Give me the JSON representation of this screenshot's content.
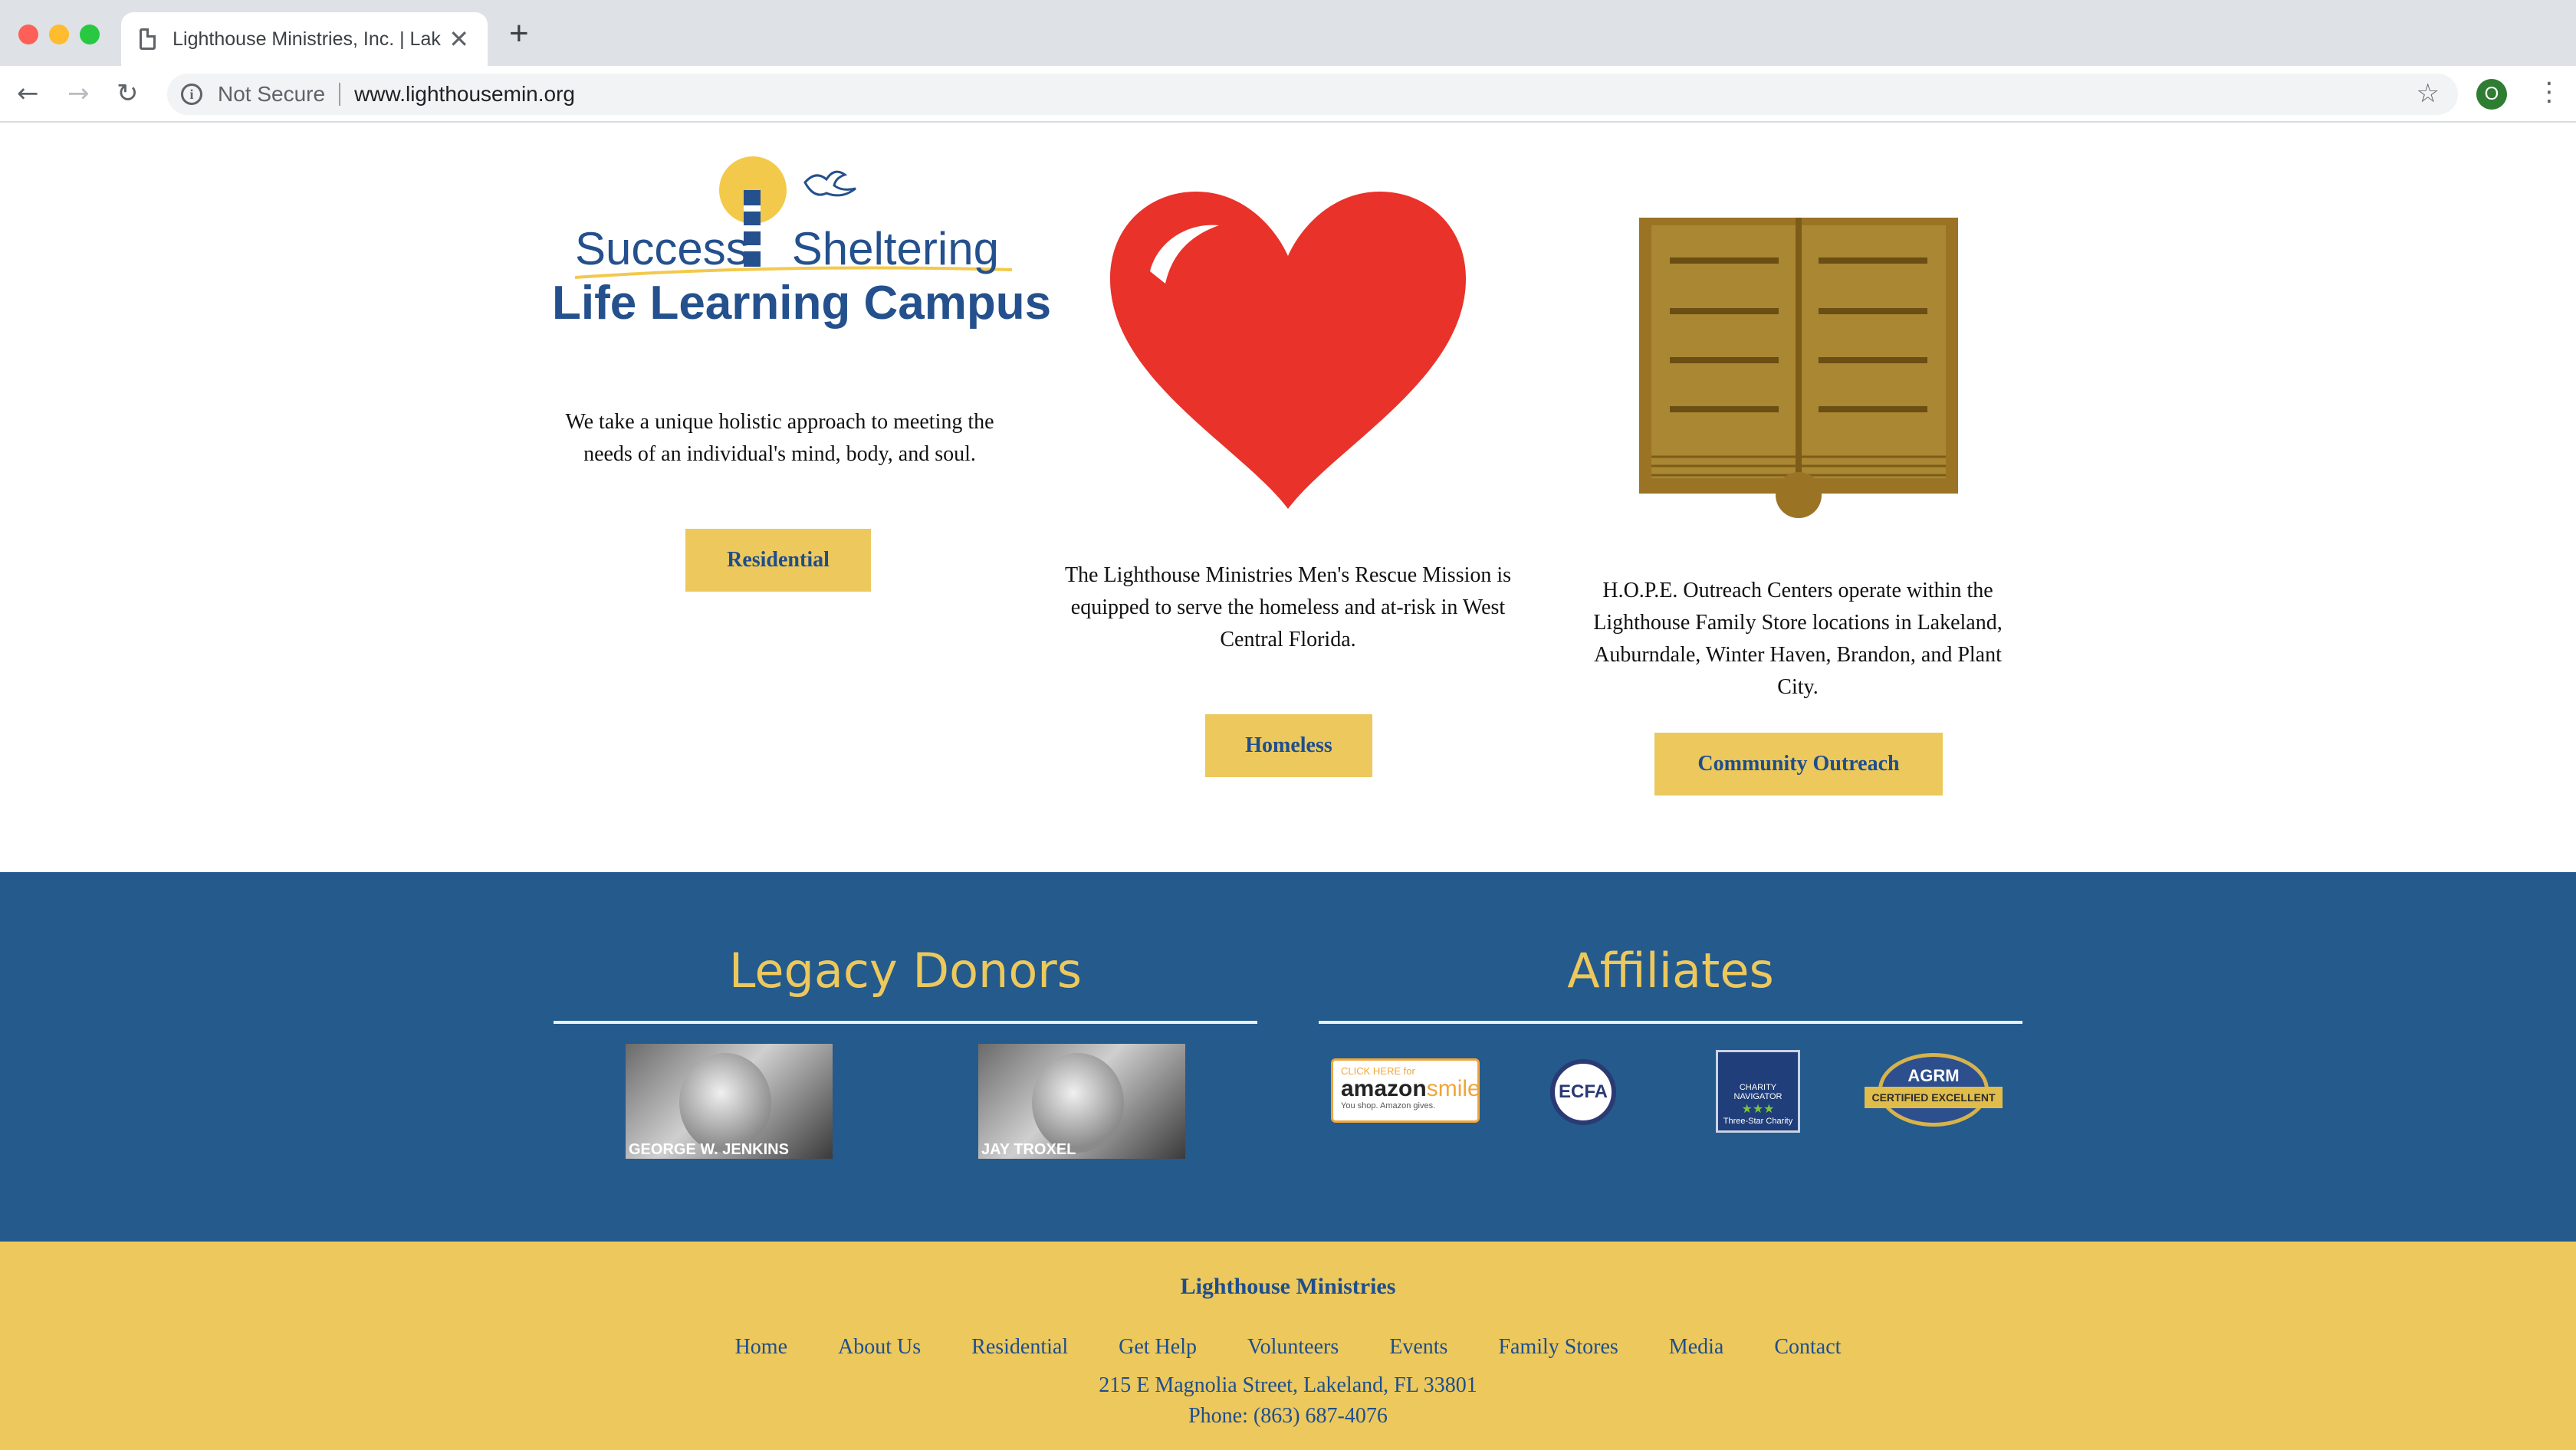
{
  "browser": {
    "tab_title": "Lighthouse Ministries, Inc. | Lakeland",
    "tab_close": "✕",
    "new_tab": "+",
    "security_label": "Not Secure",
    "url": "www.lighthousemin.org",
    "profile_initial": "O",
    "nav_back": "←",
    "nav_forward": "→",
    "nav_reload": "↻",
    "star": "☆",
    "menu": "⋮",
    "info": "i"
  },
  "logo": {
    "word1": "Success",
    "word2": "Sheltering",
    "line2": "Life Learning Campus"
  },
  "columns": {
    "residential": {
      "text": "We take a unique holistic approach to meeting the needs of an individual's mind, body, and soul.",
      "button": "Residential"
    },
    "homeless": {
      "text_line1": "The Lighthouse Ministries Men's Rescue Mission is equipped to serve the homeless and at-risk in West",
      "text_line2": "Central Florida.",
      "button": "Homeless"
    },
    "outreach": {
      "text": "H.O.P.E. Outreach Centers operate within the Lighthouse Family Store locations in Lakeland, Auburndale, Winter Haven, Brandon, and Plant City.",
      "button": "Community Outreach"
    }
  },
  "legacy": {
    "heading": "Legacy Donors",
    "donors": [
      {
        "name": "GEORGE W. JENKINS"
      },
      {
        "name": "JAY TROXEL"
      }
    ]
  },
  "affiliates": {
    "heading": "Affiliates",
    "amazon": {
      "top": "CLICK HERE for",
      "word1": "amazon",
      "word2": "smile",
      "tag": "You shop. Amazon gives."
    },
    "ecfa": "ECFA",
    "charity": {
      "title": "CHARITY NAVIGATOR",
      "stars": "★★★",
      "sub": "Three-Star Charity"
    },
    "agrm": {
      "title": "AGRM",
      "ribbon": "CERTIFIED EXCELLENT"
    }
  },
  "footer": {
    "brand": "Lighthouse Ministries",
    "nav": [
      "Home",
      "About Us",
      "Residential",
      "Get Help",
      "Volunteers",
      "Events",
      "Family Stores",
      "Media",
      "Contact"
    ],
    "address": "215 E Magnolia Street, Lakeland, FL 33801",
    "phone": "Phone: (863) 687-4076"
  },
  "colors": {
    "chrome": "#dee1e6",
    "band_blue": "#245a8c",
    "gold": "#ecc85d",
    "link_blue": "#1e4e8c",
    "heart_red": "#e8322a",
    "book_brown": "#9a7424"
  }
}
